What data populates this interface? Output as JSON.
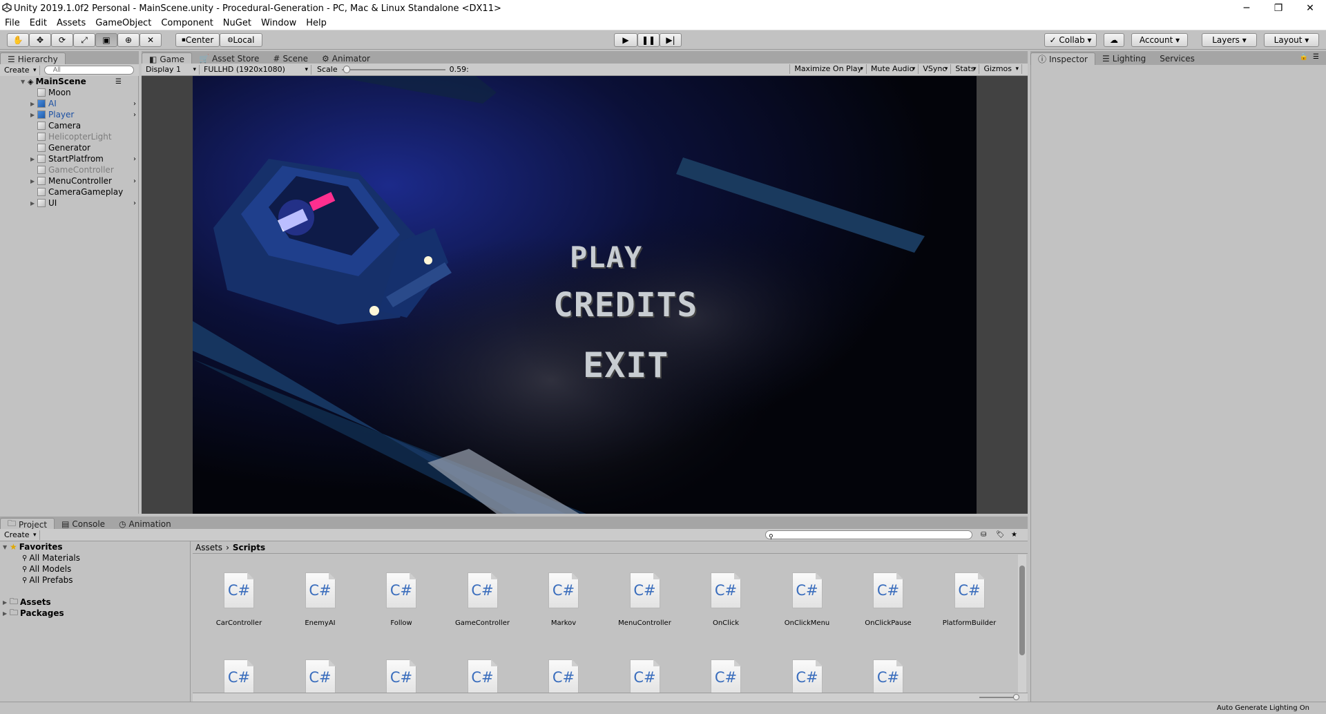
{
  "window": {
    "title": "Unity 2019.1.0f2 Personal - MainScene.unity - Procedural-Generation - PC, Mac & Linux Standalone <DX11>",
    "controls": [
      "─",
      "❐",
      "✕"
    ]
  },
  "menu": [
    "File",
    "Edit",
    "Assets",
    "GameObject",
    "Component",
    "NuGet",
    "Window",
    "Help"
  ],
  "toolbar": {
    "pivot": "Center",
    "space": "Local",
    "collab": "Collab",
    "account": "Account",
    "layers": "Layers",
    "layout": "Layout"
  },
  "hierarchy": {
    "tab": "Hierarchy",
    "create": "Create",
    "search_placeholder": "All",
    "scene": "MainScene",
    "items": [
      {
        "label": "Moon",
        "expand": false,
        "style": "normal"
      },
      {
        "label": "AI",
        "expand": true,
        "style": "blue"
      },
      {
        "label": "Player",
        "expand": true,
        "style": "blue"
      },
      {
        "label": "Camera",
        "expand": false,
        "style": "normal"
      },
      {
        "label": "HelicopterLight",
        "expand": false,
        "style": "gray"
      },
      {
        "label": "Generator",
        "expand": false,
        "style": "normal"
      },
      {
        "label": "StartPlatfrom",
        "expand": true,
        "style": "normal"
      },
      {
        "label": "GameController",
        "expand": false,
        "style": "gray"
      },
      {
        "label": "MenuController",
        "expand": true,
        "style": "normal"
      },
      {
        "label": "CameraGameplay",
        "expand": false,
        "style": "normal"
      },
      {
        "label": "UI",
        "expand": true,
        "style": "normal"
      }
    ]
  },
  "center_tabs": [
    "Game",
    "Asset Store",
    "Scene",
    "Animator"
  ],
  "game_bar": {
    "display": "Display 1",
    "resolution": "FULLHD (1920x1080)",
    "scale_label": "Scale",
    "scale_value": "0.59:",
    "right": [
      "Maximize On Play",
      "Mute Audio",
      "VSync",
      "Stats",
      "Gizmos"
    ]
  },
  "game_menu": {
    "play": "PLAY",
    "credits": "CREDITS",
    "exit": "EXIT"
  },
  "inspector_tabs": [
    "Inspector",
    "Lighting",
    "Services"
  ],
  "bottom_tabs": [
    "Project",
    "Console",
    "Animation"
  ],
  "project": {
    "create": "Create",
    "favorites_label": "Favorites",
    "favorites": [
      "All Materials",
      "All Models",
      "All Prefabs"
    ],
    "roots": [
      "Assets",
      "Packages"
    ],
    "breadcrumb": [
      "Assets",
      "Scripts"
    ],
    "files_row1": [
      "CarController",
      "EnemyAI",
      "Follow",
      "GameController",
      "Markov",
      "MenuController",
      "OnClick",
      "OnClickMenu",
      "OnClickPause",
      "PlatformBuilder"
    ],
    "files_row2_count_label": "C#",
    "icon_text": "C#"
  },
  "status": {
    "right": "Auto Generate Lighting On"
  }
}
